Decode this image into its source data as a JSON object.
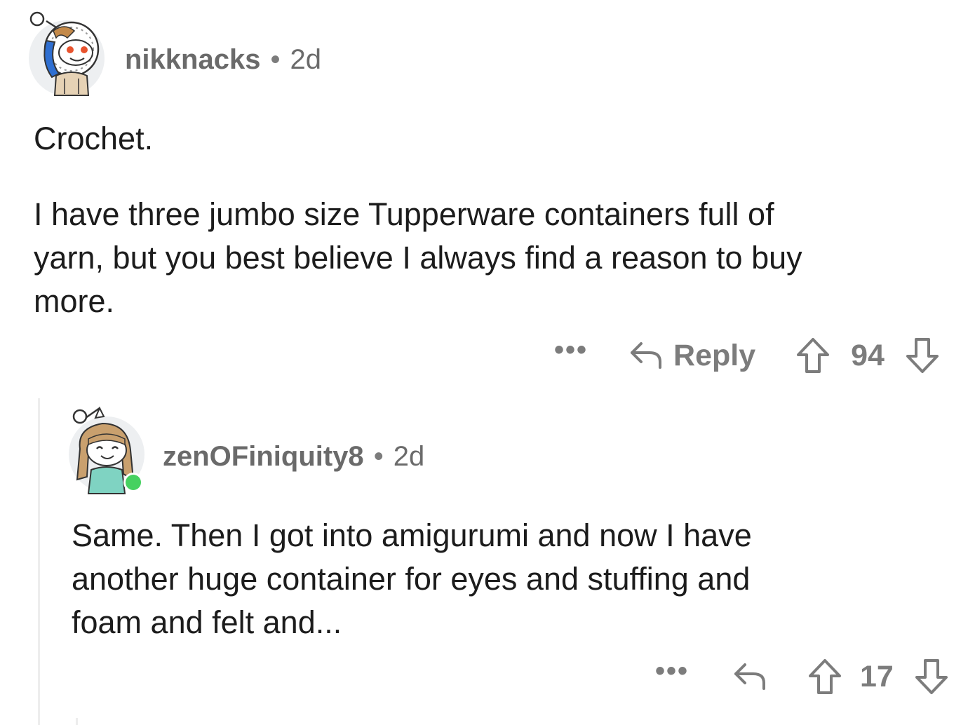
{
  "comments": [
    {
      "username": "nikknacks",
      "separator": "•",
      "age": "2d",
      "avatar_icon": "snoo-avatar-icon",
      "paragraphs": [
        "Crochet.",
        "I have three jumbo size Tupperware containers full of",
        "yarn, but you best believe I always find a reason to buy",
        "more."
      ],
      "more_label": "•••",
      "reply_label": "Reply",
      "votes": "94"
    },
    {
      "username": "zenOFiniquity8",
      "separator": "•",
      "age": "2d",
      "avatar_icon": "snoo-avatar-icon",
      "online_status_color": "#46d160",
      "paragraphs": [
        "Same. Then I got into amigurumi and now I have",
        "another huge container for eyes and stuffing and",
        "foam and felt and..."
      ],
      "more_label": "•••",
      "votes": "17"
    }
  ],
  "colors": {
    "text": "#1c1c1c",
    "meta": "#6b6b6b",
    "icon": "#7c7c7c",
    "thread_line": "#ededed"
  }
}
